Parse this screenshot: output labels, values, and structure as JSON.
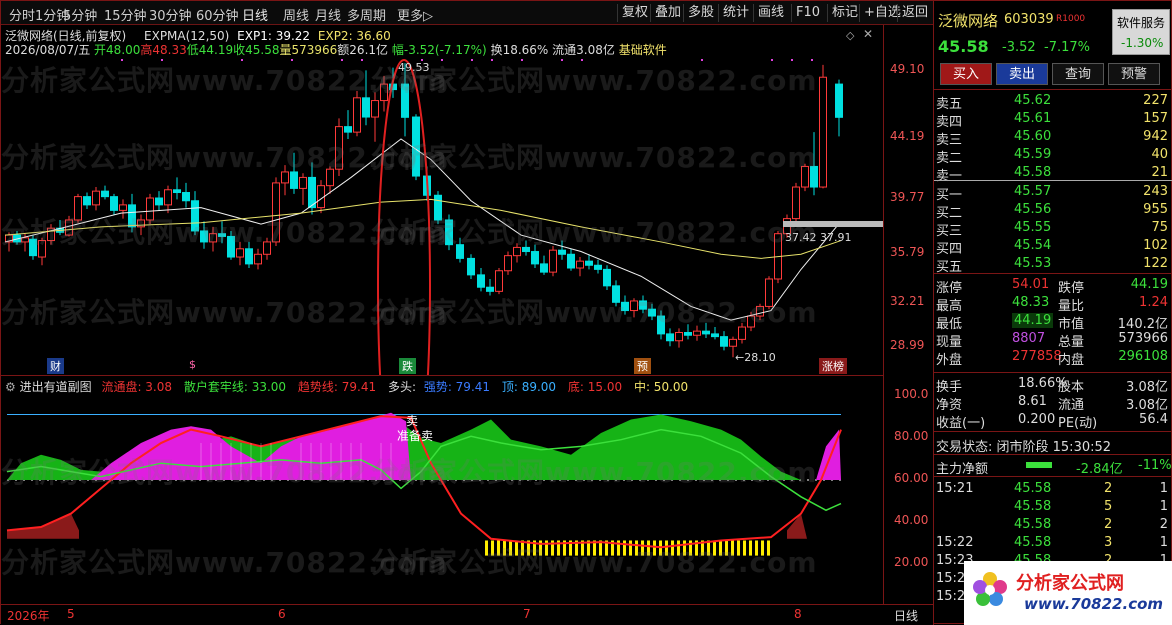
{
  "menu": {
    "left_items": [
      "分时",
      "1分钟",
      "5分钟",
      "15分钟",
      "30分钟",
      "60分钟",
      "日线",
      "周线",
      "月线",
      "多周期",
      "更多▷"
    ],
    "right_items": [
      "复权",
      "叠加",
      "多股",
      "统计",
      "画线",
      "F10",
      "标记",
      "+自选",
      "返回"
    ]
  },
  "chart_header": {
    "stock_line": "泛微网络(日线,前复权)",
    "indicator_name": "EXPMA(12,50)",
    "exp1": "EXP1: 39.22",
    "exp2": "EXP2: 36.60",
    "date": "2026/08/07/五",
    "open": "开48.00",
    "high": "高48.33",
    "low": "低44.19",
    "close": "收45.58",
    "volume": "量573966",
    "amount": "额26.1亿",
    "range": "幅-3.52(-7.17%)",
    "turnover": "换18.66%",
    "float": "流通3.08亿",
    "sector": "基础软件"
  },
  "price_axis": [
    "49.10",
    "44.19",
    "39.77",
    "35.79",
    "32.21",
    "28.99"
  ],
  "chart_labels": {
    "high_mark": "49.53",
    "low_mark": "←28.10",
    "right_box": "37.42 37.91",
    "events": [
      "财",
      "$",
      "跌",
      "预",
      "涨榜"
    ]
  },
  "sub_header": {
    "name": "进出有道副图",
    "liutongpan": "流通盘: 3.08",
    "sanhu": "散户套牢线: 33.00",
    "qushi": "趋势线: 79.41",
    "duotou": "多头:",
    "qiangshi": "强势: 79.41",
    "ding": "顶: 89.00",
    "di": "底: 15.00",
    "zhong": "中: 50.00",
    "sell": "卖",
    "prepare_sell": "准备卖"
  },
  "sub_axis": [
    "100.0",
    "80.00",
    "60.00",
    "40.00",
    "20.00"
  ],
  "time_axis": {
    "year": "2026年",
    "months": [
      "5",
      "6",
      "7",
      "8"
    ],
    "period": "日线"
  },
  "quote": {
    "name": "泛微网络",
    "code": "603039",
    "tag": "R1000",
    "software_service": "软件服务",
    "sector_change": "-1.30%",
    "price": "45.58",
    "change": "-3.52",
    "pct": "-7.17%",
    "buttons": [
      "买入",
      "卖出",
      "查询",
      "预警"
    ],
    "asks": [
      {
        "label": "卖五",
        "price": "45.62",
        "vol": "227"
      },
      {
        "label": "卖四",
        "price": "45.61",
        "vol": "157"
      },
      {
        "label": "卖三",
        "price": "45.60",
        "vol": "942"
      },
      {
        "label": "卖二",
        "price": "45.59",
        "vol": "40"
      },
      {
        "label": "卖一",
        "price": "45.58",
        "vol": "21"
      }
    ],
    "bids": [
      {
        "label": "买一",
        "price": "45.57",
        "vol": "243"
      },
      {
        "label": "买二",
        "price": "45.56",
        "vol": "955"
      },
      {
        "label": "买三",
        "price": "45.55",
        "vol": "75"
      },
      {
        "label": "买四",
        "price": "45.54",
        "vol": "102"
      },
      {
        "label": "买五",
        "price": "45.53",
        "vol": "122"
      }
    ],
    "stats": [
      {
        "l1": "涨停",
        "v1": "54.01",
        "l2": "跌停",
        "v2": "44.19"
      },
      {
        "l1": "最高",
        "v1": "48.33",
        "l2": "量比",
        "v2": "1.24"
      },
      {
        "l1": "最低",
        "v1": "44.19",
        "l2": "市值",
        "v2": "140.2亿"
      },
      {
        "l1": "现量",
        "v1": "8807",
        "l2": "总量",
        "v2": "573966"
      },
      {
        "l1": "外盘",
        "v1": "277858",
        "l2": "内盘",
        "v2": "296108"
      }
    ],
    "stats2": [
      {
        "l1": "换手",
        "v1": "18.66%",
        "l2": "股本",
        "v2": "3.08亿"
      },
      {
        "l1": "净资",
        "v1": "8.61",
        "l2": "流通",
        "v2": "3.08亿"
      },
      {
        "l1": "收益(一)",
        "v1": "0.200",
        "l2": "PE(动)",
        "v2": "56.4"
      }
    ],
    "trade_state": "交易状态: 闭市阶段 15:30:52",
    "main_net": "主力净额",
    "main_net_val": "-2.84亿",
    "main_net_pct": "-11%",
    "ticks": [
      {
        "t": "15:21",
        "p": "45.58",
        "v": "2",
        "d": "1"
      },
      {
        "t": "",
        "p": "45.58",
        "v": "5",
        "d": "1"
      },
      {
        "t": "",
        "p": "45.58",
        "v": "2",
        "d": "2"
      },
      {
        "t": "15:22",
        "p": "45.58",
        "v": "3",
        "d": "1"
      },
      {
        "t": "15:23",
        "p": "45.58",
        "v": "2",
        "d": "1"
      },
      {
        "t": "15:2",
        "p": "",
        "v": "",
        "d": ""
      },
      {
        "t": "15:2",
        "p": "",
        "v": "",
        "d": ""
      }
    ]
  },
  "watermark": "分析家公式网www.70822.com",
  "logo": {
    "cn": "分析家公式网",
    "url": "www.70822.com"
  }
}
